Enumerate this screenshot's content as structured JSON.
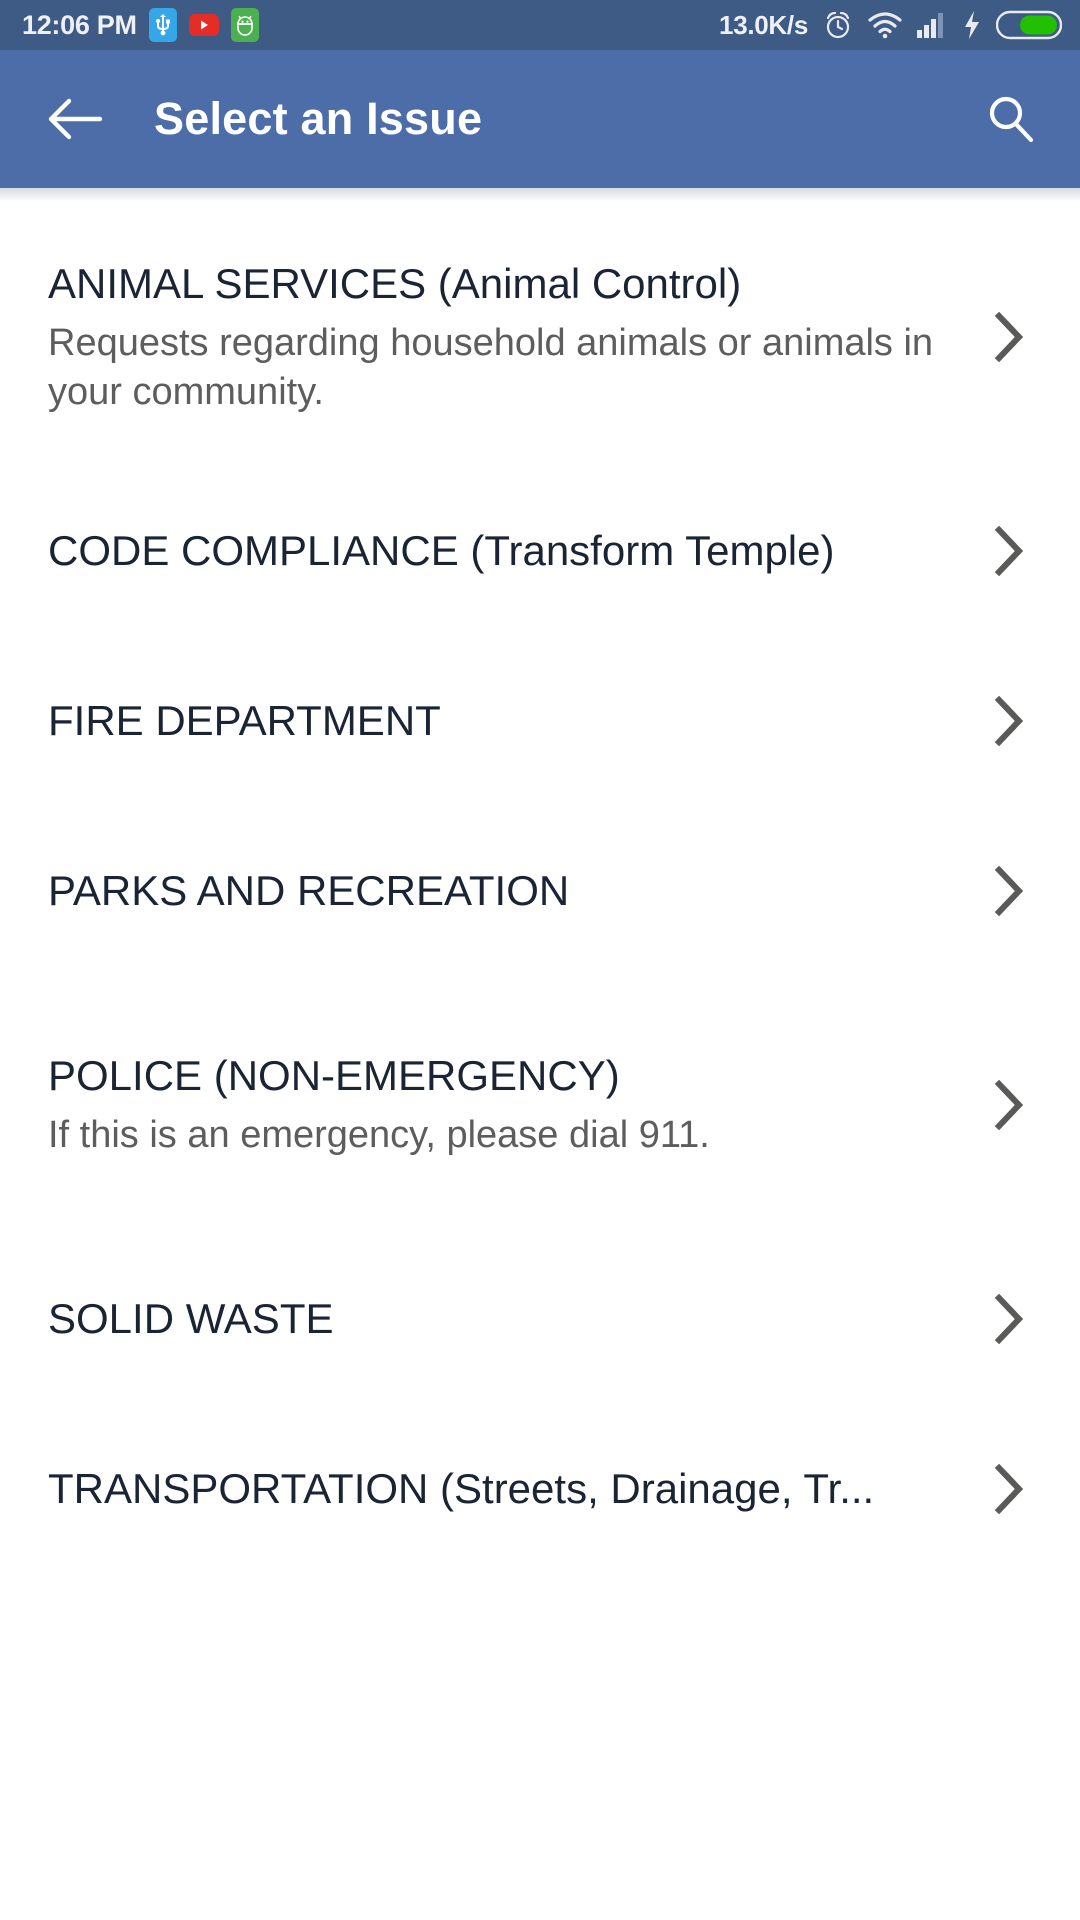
{
  "status_bar": {
    "time": "12:06 PM",
    "network_speed": "13.0K/s",
    "left_icons": [
      "usb-icon",
      "youtube-icon",
      "android-bug-icon"
    ],
    "right_icons": [
      "alarm-icon",
      "wifi-icon",
      "signal-icon",
      "charging-bolt-icon",
      "battery-icon"
    ],
    "battery_level": 62,
    "signal_bars": 3,
    "background_color": "#3d5b85"
  },
  "app_bar": {
    "title": "Select an Issue",
    "back_icon": "arrow-left-icon",
    "search_icon": "search-icon",
    "background_color": "#4c6da7",
    "text_color": "#ffffff"
  },
  "list": {
    "chevron_icon": "chevron-right-icon",
    "chevron_color": "#5a5a58",
    "title_color": "#1b2434",
    "subtitle_color": "#5d5d5d",
    "items": [
      {
        "title": "ANIMAL SERVICES (Animal Control)",
        "subtitle": "Requests regarding household animals or animals in your community."
      },
      {
        "title": "CODE COMPLIANCE (Transform Temple)",
        "subtitle": ""
      },
      {
        "title": "FIRE DEPARTMENT",
        "subtitle": ""
      },
      {
        "title": "PARKS AND RECREATION",
        "subtitle": ""
      },
      {
        "title": "POLICE (NON-EMERGENCY)",
        "subtitle": "If this is an emergency, please dial 911."
      },
      {
        "title": "SOLID WASTE",
        "subtitle": ""
      },
      {
        "title": "TRANSPORTATION (Streets, Drainage, Tr...",
        "subtitle": ""
      }
    ]
  }
}
